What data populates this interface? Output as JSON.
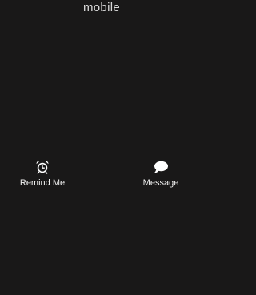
{
  "call_screen": {
    "caller_label": "mobile"
  },
  "actions": {
    "remind": {
      "label": "Remind Me",
      "icon": "alarm-clock-icon"
    },
    "message": {
      "label": "Message",
      "icon": "speech-bubble-icon"
    }
  },
  "colors": {
    "background": "#191818",
    "text": "#ffffff"
  }
}
